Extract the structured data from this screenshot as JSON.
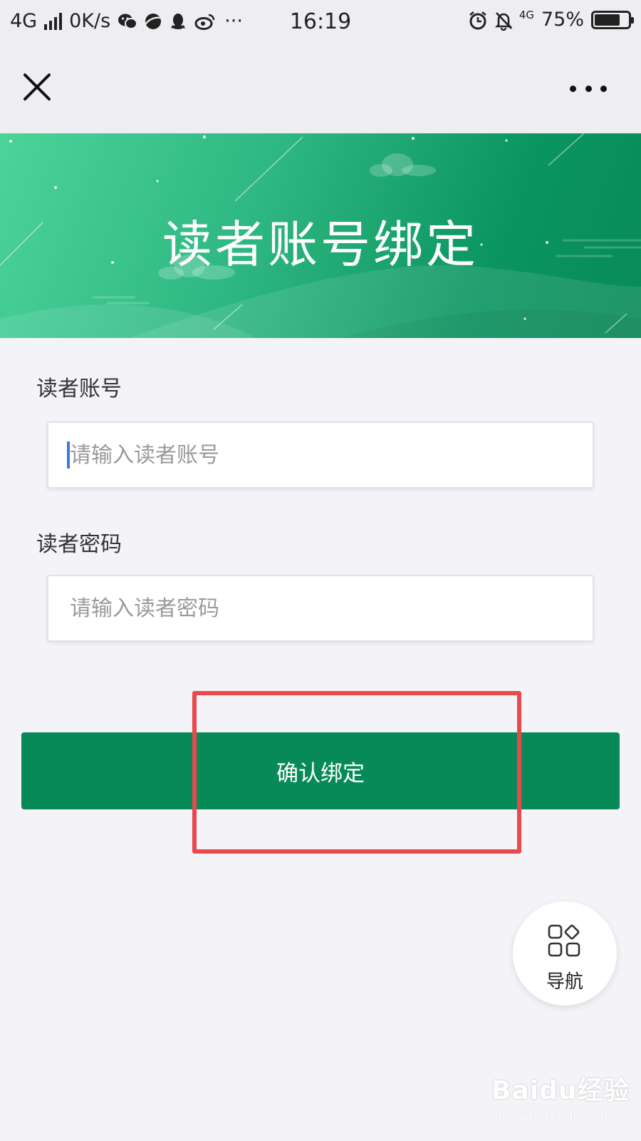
{
  "status_bar": {
    "network": "4G",
    "speed": "0K/s",
    "app_icons": [
      "wechat-icon",
      "browser-icon",
      "qq-icon",
      "weibo-icon"
    ],
    "more": "···",
    "time": "16:19",
    "network_right": "4G",
    "battery": "75%",
    "battery_level": 0.75
  },
  "nav": {
    "close_icon": "close-icon",
    "more_icon": "more-icon"
  },
  "banner": {
    "title": "读者账号绑定"
  },
  "form": {
    "account": {
      "label": "读者账号",
      "value": "",
      "placeholder": "请输入读者账号"
    },
    "password": {
      "label": "读者密码",
      "value": "",
      "placeholder": "请输入读者密码"
    },
    "confirm_label": "确认绑定"
  },
  "fab": {
    "label": "导航",
    "icon": "grid-menu-icon"
  },
  "watermark": {
    "main": "Baidu经验",
    "sub": "jingyan.baidu.com"
  },
  "colors": {
    "primary": "#078a57",
    "banner_light": "#4bd39a",
    "highlight": "#e8494d",
    "background": "#f4f3f7"
  }
}
